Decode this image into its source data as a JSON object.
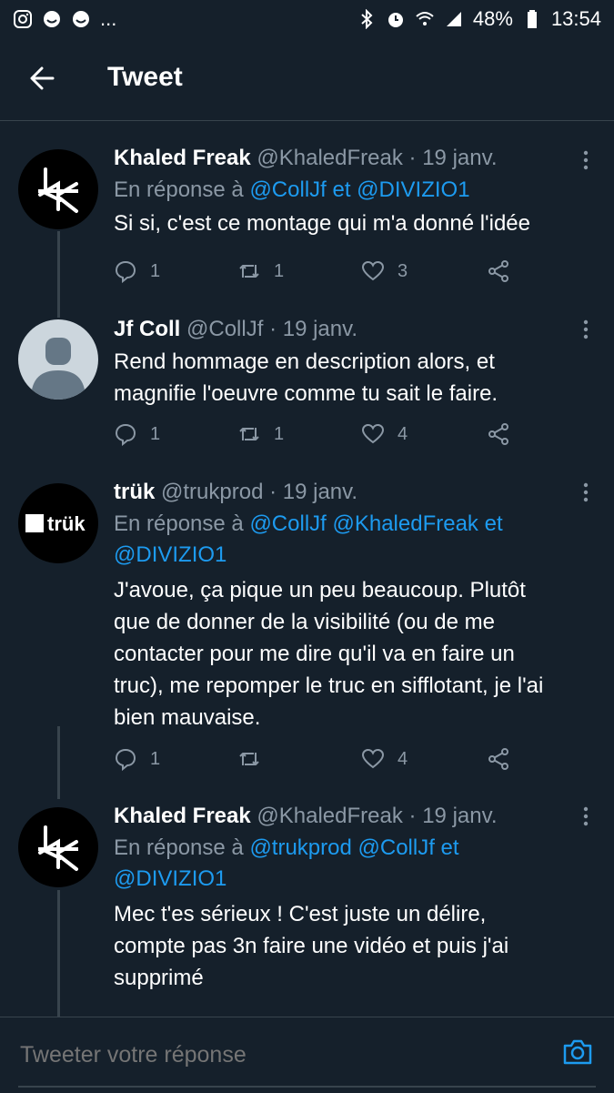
{
  "status_bar": {
    "battery": "48%",
    "time": "13:54",
    "left_icons": [
      "instagram-icon",
      "face-icon",
      "face-icon"
    ],
    "more": "...",
    "right_icons": [
      "bluetooth-icon",
      "alarm-icon",
      "wifi-icon",
      "signal-icon",
      "battery-icon"
    ]
  },
  "header": {
    "title": "Tweet"
  },
  "tweets": [
    {
      "name": "Khaled Freak",
      "handle": "@KhaledFreak",
      "date": "19 janv.",
      "reply_prefix": "En réponse à ",
      "reply_mentions": "@CollJf et @DIVIZIO1",
      "text": "Si si, c'est ce montage qui m'a donné l'idée",
      "replies": "1",
      "retweets": "1",
      "likes": "3"
    },
    {
      "name": "Jf Coll",
      "handle": "@CollJf",
      "date": "19 janv.",
      "text": "Rend hommage en description alors, et magnifie l'oeuvre comme tu sait le faire.",
      "replies": "1",
      "retweets": "1",
      "likes": "4"
    },
    {
      "name": "trük",
      "handle": "@trukprod",
      "date": "19 janv.",
      "avatar_text": "trük",
      "reply_prefix": "En réponse à ",
      "reply_mentions": "@CollJf @KhaledFreak et @DIVIZIO1",
      "text": "J'avoue, ça pique un peu beaucoup. Plutôt que de donner de la visibilité (ou de me contacter pour me dire qu'il va en faire un truc), me repomper le truc en sifflotant, je l'ai bien mauvaise.",
      "replies": "1",
      "retweets": "",
      "likes": "4"
    },
    {
      "name": "Khaled Freak",
      "handle": "@KhaledFreak",
      "date": "19 janv.",
      "reply_prefix": "En réponse à ",
      "reply_mentions": "@trukprod @CollJf et @DIVIZIO1",
      "text": "Mec t'es sérieux ! C'est juste un délire, compte pas 3n faire une vidéo et puis j'ai supprimé"
    }
  ],
  "reply_bar": {
    "placeholder": "Tweeter votre réponse"
  },
  "colors": {
    "background": "#15202b",
    "accent": "#1d9bf0",
    "muted": "#8b98a5",
    "divider": "#38444d"
  }
}
